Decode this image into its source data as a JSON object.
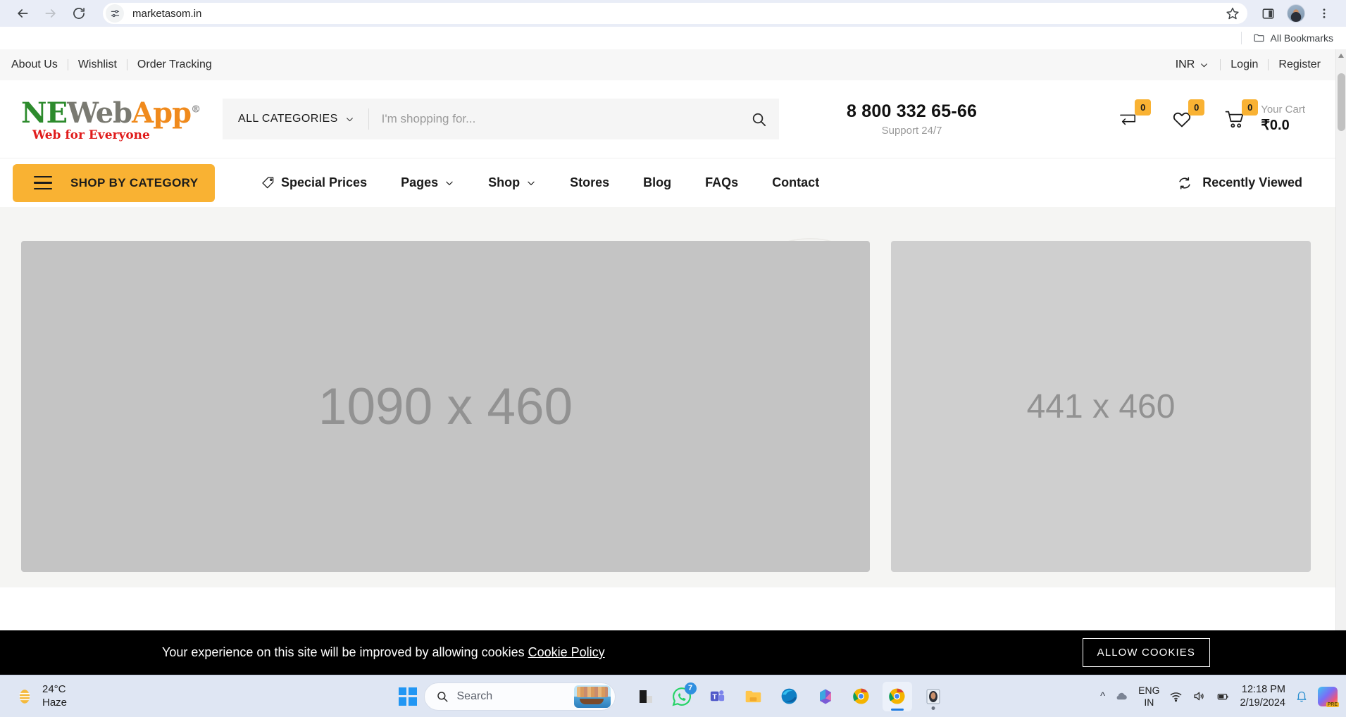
{
  "browser": {
    "back_icon": "back-arrow-icon",
    "forward_icon": "forward-arrow-icon",
    "reload_icon": "reload-icon",
    "site_info_icon": "site-settings-icon",
    "url": "marketasom.in",
    "bookmark_icon": "star-icon",
    "split_icon": "split-screen-icon",
    "profile_icon": "profile-avatar",
    "menu_icon": "three-dot-menu-icon",
    "bookmarks_bar": {
      "folder_icon": "folder-icon",
      "all_bookmarks_label": "All Bookmarks"
    }
  },
  "topbar": {
    "links": [
      "About Us",
      "Wishlist",
      "Order Tracking"
    ],
    "currency": "INR",
    "currency_caret": "chevron-down-icon",
    "login": "Login",
    "register": "Register"
  },
  "header": {
    "logo": {
      "part1": "NE",
      "part2": "Web",
      "part3": "App",
      "registered": "®",
      "tagline": "Web for Everyone"
    },
    "search": {
      "category_label": "ALL CATEGORIES",
      "category_caret": "chevron-down-icon",
      "placeholder": "I'm shopping for...",
      "value": "",
      "search_icon": "search-icon"
    },
    "phone": {
      "number": "8 800 332 65-66",
      "support": "Support 24/7"
    },
    "actions": {
      "compare": {
        "icon": "compare-arrows-icon",
        "count": "0"
      },
      "wishlist": {
        "icon": "heart-icon",
        "count": "0"
      },
      "cart": {
        "icon": "shopping-cart-icon",
        "count": "0",
        "label": "Your Cart",
        "price": "₹0.0"
      }
    }
  },
  "mainnav": {
    "shop_by_category": {
      "menu_icon": "hamburger-menu-icon",
      "label": "SHOP BY CATEGORY"
    },
    "links": [
      {
        "label": "Special Prices",
        "icon": "price-tag-icon",
        "caret": false
      },
      {
        "label": "Pages",
        "icon": null,
        "caret": true
      },
      {
        "label": "Shop",
        "icon": null,
        "caret": true
      },
      {
        "label": "Stores",
        "icon": null,
        "caret": false
      },
      {
        "label": "Blog",
        "icon": null,
        "caret": false
      },
      {
        "label": "FAQs",
        "icon": null,
        "caret": false
      },
      {
        "label": "Contact",
        "icon": null,
        "caret": false
      }
    ],
    "recently_viewed": {
      "icon": "refresh-cycle-icon",
      "label": "Recently Viewed"
    }
  },
  "hero": {
    "large_placeholder": "1090 x 460",
    "small_placeholder": "441 x 460"
  },
  "cookie_banner": {
    "message": "Your experience on this site will be improved by allowing cookies ",
    "link_label": "Cookie Policy",
    "button_label": "ALLOW COOKIES"
  },
  "taskbar": {
    "weather": {
      "icon": "weather-haze-icon",
      "temperature": "24°C",
      "condition": "Haze"
    },
    "start_icon": "windows-start-icon",
    "search": {
      "icon": "search-icon",
      "placeholder": "Search",
      "thumbnail": "venice-boats-thumbnail"
    },
    "apps": [
      {
        "name": "file-explorer-dark-icon",
        "badge": null
      },
      {
        "name": "whatsapp-icon",
        "badge": "7"
      },
      {
        "name": "microsoft-teams-icon",
        "badge": null
      },
      {
        "name": "file-explorer-icon",
        "badge": null
      },
      {
        "name": "microsoft-edge-icon",
        "badge": null
      },
      {
        "name": "microsoft-365-icon",
        "badge": null
      },
      {
        "name": "google-chrome-icon",
        "badge": null
      },
      {
        "name": "google-chrome-active-icon",
        "badge": null
      },
      {
        "name": "photos-app-icon",
        "badge": null
      }
    ],
    "tray": {
      "chevron_icon": "show-hidden-icons-chevron",
      "cloud_icon": "onedrive-cloud-icon",
      "language": {
        "line1": "ENG",
        "line2": "IN"
      },
      "wifi_icon": "wifi-icon",
      "volume_icon": "speaker-icon",
      "battery_icon": "battery-icon",
      "time": "12:18 PM",
      "date": "2/19/2024",
      "notification_icon": "bell-icon",
      "copilot_icon": "copilot-icon",
      "copilot_badge": "PRE"
    }
  },
  "colors": {
    "accent_orange": "#f9b233",
    "logo_green": "#2d8b2d",
    "logo_red": "#e01b1b",
    "chrome_bg": "#e9edf7",
    "taskbar_bg": "#dfe6f3"
  }
}
